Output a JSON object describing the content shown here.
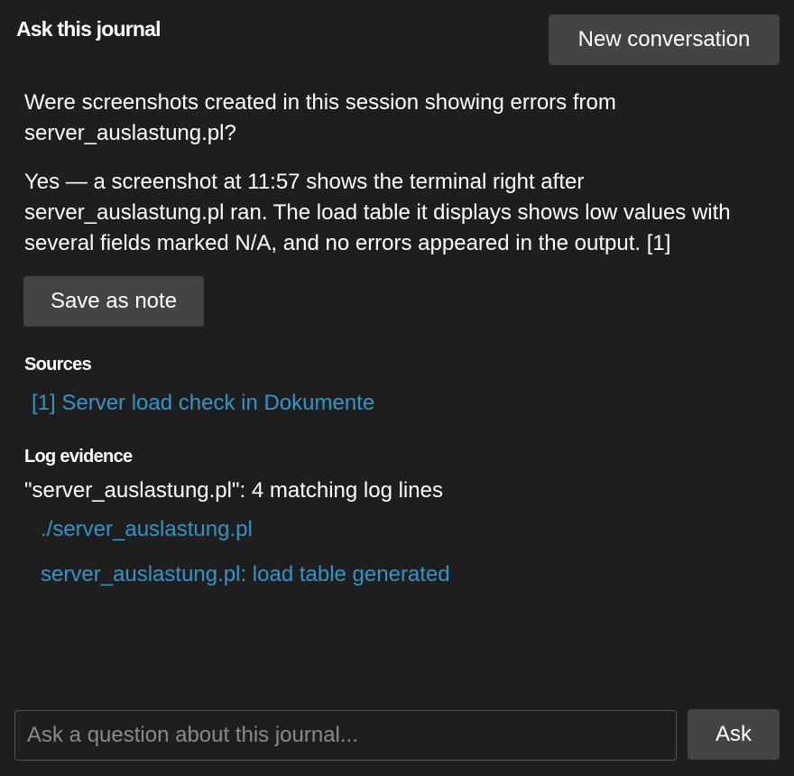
{
  "header": {
    "title": "Ask this journal",
    "new_conversation_label": "New conversation"
  },
  "conversation": {
    "question": "Were screenshots created in this session showing errors from server_auslastung.pl?",
    "answer": "Yes — a screenshot at 11:57 shows the terminal right after server_auslastung.pl ran. The load table it displays shows low values with several fields marked N/A, and no errors appeared in the output. [1]",
    "save_note_label": "Save as note"
  },
  "sources": {
    "heading": "Sources",
    "items": [
      {
        "label": "[1] Server load check in Dokumente"
      }
    ]
  },
  "log_evidence": {
    "heading": "Log evidence",
    "summary": "\"server_auslastung.pl\": 4 matching log lines",
    "links": [
      {
        "label": "./server_auslastung.pl"
      },
      {
        "label": "server_auslastung.pl: load table generated"
      }
    ]
  },
  "composer": {
    "placeholder": "Ask a question about this journal...",
    "value": "",
    "ask_label": "Ask"
  },
  "colors": {
    "background": "#1e1e1e",
    "button": "#444444",
    "link": "#2f96c8",
    "text": "#ffffff"
  }
}
